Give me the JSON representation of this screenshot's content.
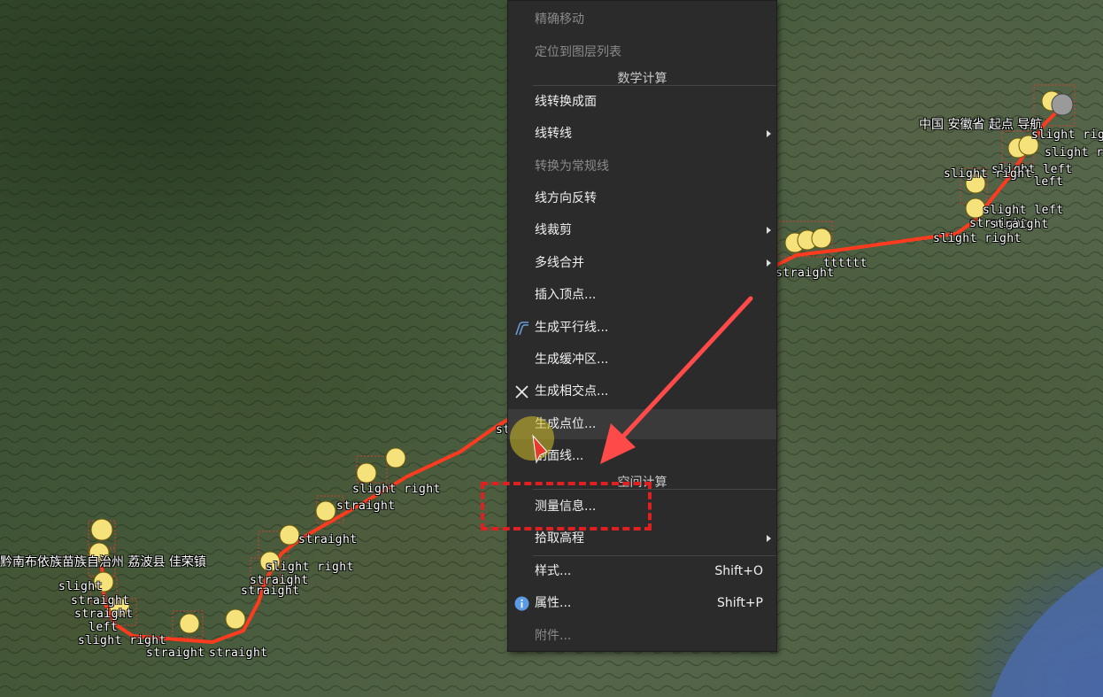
{
  "map": {
    "place_label_top": "中国 安徽省 起点 导航",
    "place_label_left": "黔南布依族苗族自治州 荔波县 佳荣镇",
    "route_labels": [
      "slight right",
      "slight right",
      "slight left",
      "straight",
      "slight right",
      "straight",
      "straight",
      "slight right",
      "straight",
      "straight",
      "straight",
      "slight left",
      "slight right",
      "slight",
      "straight",
      "left",
      "straight",
      "straight",
      "straight",
      "slight right",
      "straight",
      "straight",
      "left",
      "tttttt",
      "slight right"
    ]
  },
  "context_menu": {
    "items": [
      {
        "label": "精确移动",
        "disabled": true
      },
      {
        "label": "定位到图层列表",
        "disabled": true
      },
      {
        "section": "数学计算"
      },
      {
        "label": "线转换成面"
      },
      {
        "label": "线转线",
        "submenu": true
      },
      {
        "label": "转换为常规线",
        "disabled": true
      },
      {
        "label": "线方向反转"
      },
      {
        "label": "线裁剪",
        "submenu": true
      },
      {
        "label": "多线合并",
        "submenu": true
      },
      {
        "label": "插入顶点..."
      },
      {
        "label": "生成平行线...",
        "icon": "parallel-lines-icon"
      },
      {
        "label": "生成缓冲区..."
      },
      {
        "label": "生成相交点...",
        "icon": "intersect-x-icon"
      },
      {
        "label": "生成点位...",
        "hover": true
      },
      {
        "label": "剖面线..."
      },
      {
        "section": "空间计算"
      },
      {
        "label": "测量信息..."
      },
      {
        "label": "拾取高程",
        "submenu": true
      },
      {
        "label": "样式...",
        "shortcut": "Shift+O"
      },
      {
        "label": "属性...",
        "shortcut": "Shift+P",
        "icon": "info-icon"
      },
      {
        "label": "附件...",
        "disabled": true
      }
    ]
  },
  "colors": {
    "menu_bg": "#2b2b2b",
    "route": "#ff3b1f",
    "annotation": "#e02020",
    "pin": "#f5e27a"
  }
}
